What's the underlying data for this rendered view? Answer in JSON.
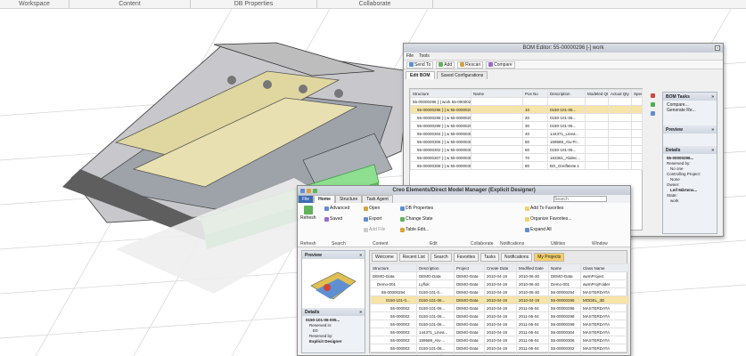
{
  "top_nav": [
    "Workspace",
    "Content",
    "DB Properties",
    "Collaborate"
  ],
  "colors": {
    "accent": "#f6cf69",
    "selection": "#f6e4a8",
    "title_blue": "#2d5fa5"
  },
  "bom": {
    "title": "BOM Editor: 55-00000296 [-] work",
    "menu": [
      "File",
      "Tools"
    ],
    "toolbar": [
      "Send To",
      "Add",
      "Rescan",
      "Compare"
    ],
    "tabs": [
      "Edit BOM",
      "Saved Configurations"
    ],
    "columns": [
      "Structure",
      "Name",
      "Pos No",
      "Description",
      "Modeled Qty",
      "Actual Qty",
      "Spec"
    ],
    "rows": [
      [
        "55-00000296 [-] work 55-00000294",
        "",
        "",
        "",
        "",
        "",
        ""
      ],
      [
        "55-00000296 [-] w 55-00000296",
        "",
        "10",
        "0150-101-06...",
        "",
        "",
        ""
      ],
      [
        "55-00000298 [-] w 55-00000298",
        "",
        "20",
        "0150-101-06...",
        "",
        "",
        ""
      ],
      [
        "55-00000299 [-] w 55-00000299",
        "",
        "30",
        "0150-101-06...",
        "",
        "",
        ""
      ],
      [
        "55-00000304 [-] w 55-00000304",
        "",
        "40",
        "144371_Linea...",
        "",
        "",
        ""
      ],
      [
        "55-00000306 [-] w 55-00000306",
        "",
        "50",
        "159589_Alu-Pr...",
        "",
        "",
        ""
      ],
      [
        "55-00000302 [-] w 55-00000302",
        "",
        "60",
        "0150-101-06...",
        "",
        "",
        ""
      ],
      [
        "55-00000307 [-] w 55-00000307",
        "",
        "70",
        "163361_Abdec...",
        "",
        "",
        ""
      ],
      [
        "55-00000308 [-] w 55-00000308",
        "",
        "80",
        "BG_Greifleiste.1",
        "",
        "",
        ""
      ]
    ],
    "side_panels": {
      "tasks_title": "BOM Tasks",
      "tasks": [
        "Compare...",
        "Generate Re..."
      ],
      "preview_title": "Preview",
      "details_title": "Details",
      "details": [
        "55-00000296...",
        "Reserved by:",
        "No one",
        "Controlling Project:",
        "None",
        "Owner:",
        "Leif Mårtens...",
        "State:",
        "work"
      ]
    }
  },
  "mm": {
    "title": "Creo Elements/Direct Model Manager (Explicit Designer)",
    "ribbon_tabs": [
      "File",
      "Home",
      "Structure",
      "Task Agent"
    ],
    "search_placeholder": "Search",
    "ribbon": {
      "refresh": "Refresh",
      "advanced": "Advanced",
      "saved": "Saved",
      "open": "Open",
      "export": "Export",
      "add_file": "Add File",
      "db_properties": "DB Properties",
      "change_state": "Change State",
      "table_edit": "Table Edit...",
      "add_to_favorites": "Add To Favorites",
      "organize_favorites": "Organize Favorites...",
      "expand_all": "Expand All",
      "groups": [
        "Refresh",
        "Search",
        "Content",
        "Edit",
        "Collaborate",
        "Notifications",
        "Utilities",
        "Window"
      ]
    },
    "left": {
      "preview_title": "Preview",
      "details_title": "Details",
      "details": [
        "0150-101-06-005...",
        "Reserved in:",
        "E0",
        "Reserved by:",
        "Explicit Designer"
      ]
    },
    "subtabs": [
      "Welcome",
      "Recent List",
      "Search",
      "Favorites",
      "Tasks",
      "Notifications",
      "My Projects"
    ],
    "columns": [
      "Structure",
      "Description",
      "Project",
      "Create Date",
      "Modified Date",
      "Name",
      "Class Name"
    ],
    "rows": [
      [
        "DEMO-Data",
        "DEMO-Data",
        "DEMO-Data",
        "2010-04-19",
        "2010-06-30",
        "DEMO-Data",
        "awmProject"
      ],
      [
        "Demo-001",
        "Lyflok",
        "DEMO-Data",
        "2010-04-19",
        "2010-06-30",
        "Demo-001",
        "awmProjFolder"
      ],
      [
        "55-00000294",
        "0150-101-0...",
        "DEMO-Data",
        "2010-04-19",
        "2010-05-30",
        "55-00000294",
        "MASTERDATA"
      ],
      [
        "0150-101-0...",
        "0150-101-06...",
        "DEMO-Data",
        "2010-04-19",
        "2010-04-19",
        "55-00000295",
        "MODEL_3D"
      ],
      [
        "55-000002",
        "0150-101-06...",
        "DEMO-Data",
        "2010-04-19",
        "2011-05-04",
        "55-00000296",
        "MASTERDATA"
      ],
      [
        "55-000002",
        "0150-101-06...",
        "DEMO-Data",
        "2010-04-19",
        "2011-05-04",
        "55-00000298",
        "MASTERDATA"
      ],
      [
        "55-000003",
        "0150-101-06...",
        "DEMO-Data",
        "2010-04-19",
        "2011-05-04",
        "55-00000299",
        "MASTERDATA"
      ],
      [
        "55-000003",
        "144371_Linea...",
        "DEMO-Data",
        "2010-04-19",
        "2011-05-04",
        "55-00000304",
        "MASTERDATA"
      ],
      [
        "55-000003",
        "159589_Alu-...",
        "DEMO-Data",
        "2010-04-19",
        "2011-05-04",
        "55-00000306",
        "MASTERDATA"
      ],
      [
        "55-000003",
        "0150-101-06...",
        "DEMO-Data",
        "2010-04-19",
        "2011-05-04",
        "55-00000302",
        "MASTERDATA"
      ],
      [
        "55-000003",
        "163361_Abde...",
        "DEMO-Data",
        "2010-04-19",
        "2011-05-04",
        "55-00000307",
        "MASTERDATA"
      ],
      [
        "55-000003",
        "BG_Greifl...",
        "DEMO-Data",
        "2010-04-19",
        "2011-05-04",
        "55-00000308",
        "MASTERDATA"
      ]
    ]
  }
}
